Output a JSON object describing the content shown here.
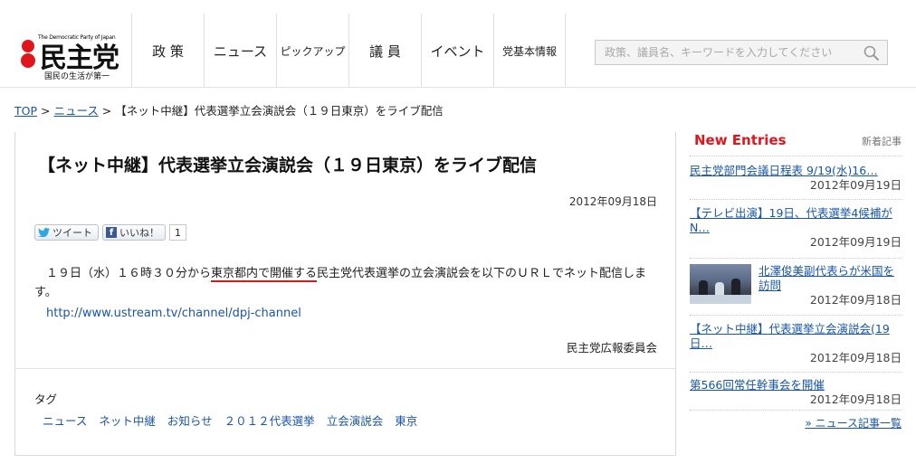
{
  "logo": {
    "tagline": "The Democratic Party of Japan",
    "name": "民主党",
    "slogan": "国民の生活が第一"
  },
  "nav": [
    {
      "label": "政 策"
    },
    {
      "label": "ニュース"
    },
    {
      "label": "ピックアップ"
    },
    {
      "label": "議 員"
    },
    {
      "label": "イベント"
    },
    {
      "label": "党基本情報"
    }
  ],
  "search": {
    "placeholder": "政策、議員名、キーワードを入力してください",
    "icon": "search-icon"
  },
  "breadcrumb": {
    "top": "TOP",
    "sep1": " > ",
    "news": "ニュース",
    "sep2": " > ",
    "current": "【ネット中継】代表選挙立会演説会（１９日東京）をライブ配信"
  },
  "article": {
    "title": "【ネット中継】代表選挙立会演説会（１９日東京）をライブ配信",
    "date": "2012年09月18日",
    "share": {
      "tweet_label": "ツイート",
      "like_label": "いいね！",
      "like_count": "1"
    },
    "body_pre": "　１９日（水）１６時３０分から",
    "body_highlight": "東京都内で開催する",
    "body_post": "民主党代表選挙の立会演説会を以下のＵＲＬでネット配信します。",
    "link": "http://www.ustream.tv/channel/dpj-channel",
    "signature": "民主党広報委員会",
    "tags_label": "タグ",
    "tags": [
      "ニュース",
      "ネット中継",
      "お知らせ",
      "２０１２代表選挙",
      "立会演説会",
      "東京"
    ]
  },
  "sidebar": {
    "heading": "New Entries",
    "subheading": "新着記事",
    "entries": [
      {
        "title": "民主党部門会議日程表 9/19(水)16…",
        "date": "2012年09月19日"
      },
      {
        "title": "【テレビ出演】19日、代表選挙4候補が N…",
        "date": "2012年09月19日"
      },
      {
        "title": "北澤俊美副代表らが米国を訪問",
        "date": "2012年09月18日"
      },
      {
        "title": "【ネット中継】代表選挙立会演説会(19日…",
        "date": "2012年09月18日"
      },
      {
        "title": "第566回常任幹事会を開催",
        "date": "2012年09月18日"
      }
    ],
    "more": "» ニュース記事一覧"
  },
  "colors": {
    "accent_red": "#e0161e",
    "link_blue": "#1a55a6"
  }
}
